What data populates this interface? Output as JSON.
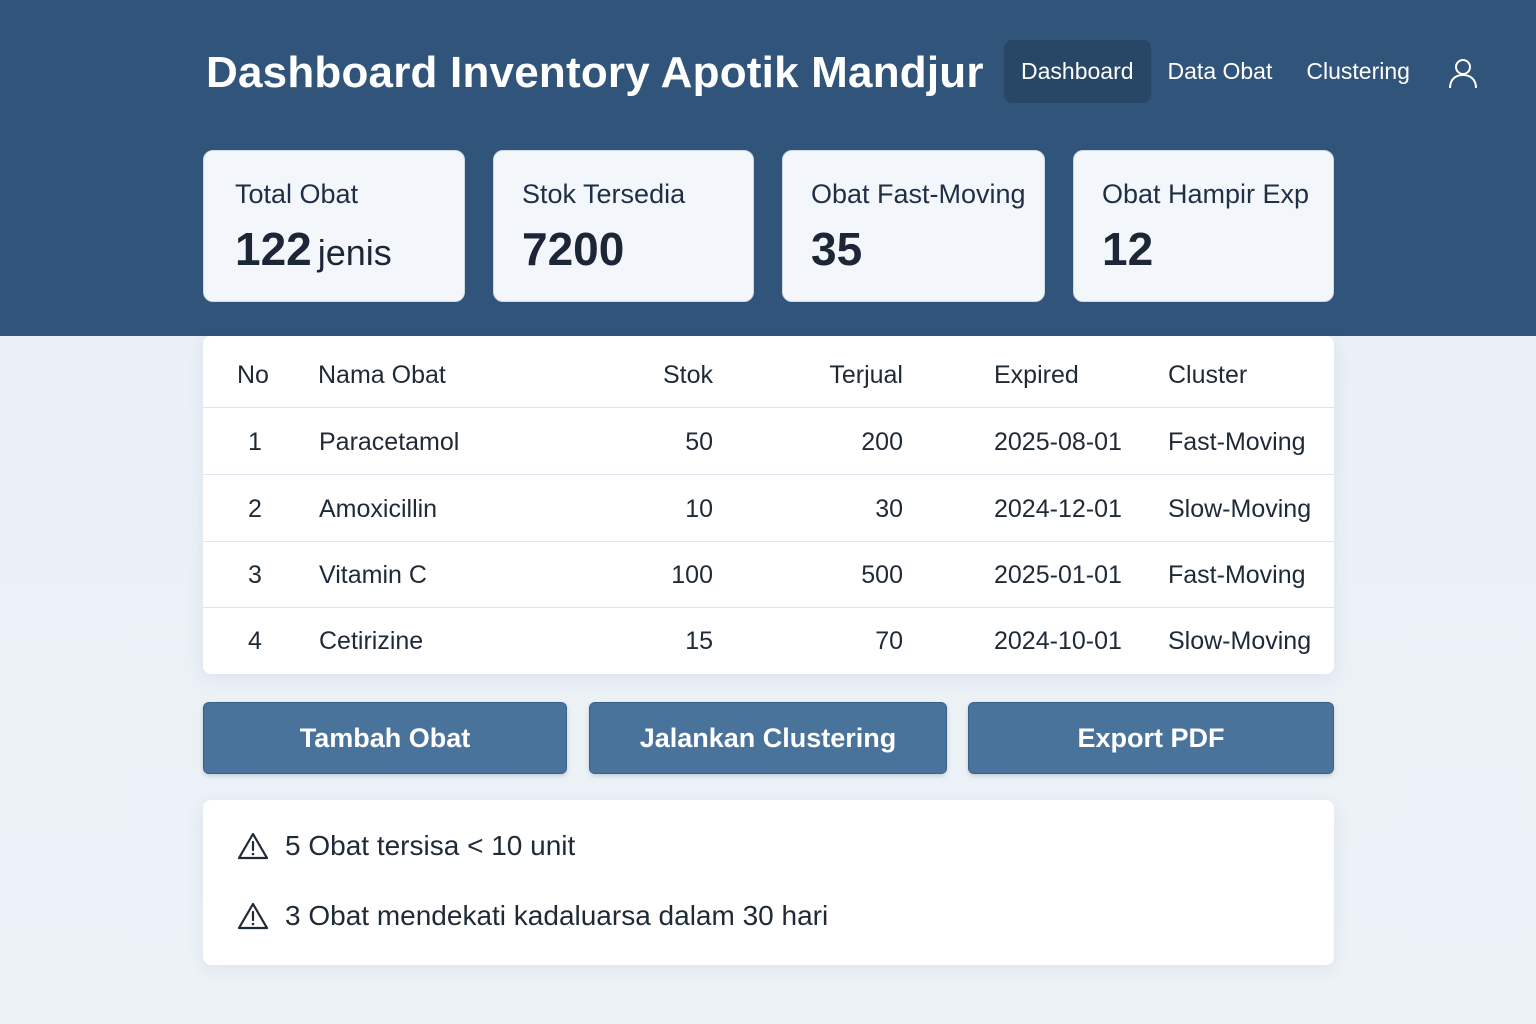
{
  "app": {
    "title": "Dashboard Inventory Apotik Mandjur"
  },
  "nav": {
    "items": [
      {
        "label": "Dashboard",
        "active": true
      },
      {
        "label": "Data Obat",
        "active": false
      },
      {
        "label": "Clustering",
        "active": false
      }
    ],
    "user_icon": "user-icon"
  },
  "stats": [
    {
      "label": "Total Obat",
      "value": "122",
      "unit": "jenis"
    },
    {
      "label": "Stok Tersedia",
      "value": "7200",
      "unit": ""
    },
    {
      "label": "Obat Fast-Moving",
      "value": "35",
      "unit": ""
    },
    {
      "label": "Obat Hampir Exp",
      "value": "12",
      "unit": ""
    }
  ],
  "table": {
    "headers": [
      "No",
      "Nama Obat",
      "Stok",
      "Terjual",
      "Expired",
      "Cluster"
    ],
    "rows": [
      [
        "1",
        "Paracetamol",
        "50",
        "200",
        "2025-08-01",
        "Fast-Moving"
      ],
      [
        "2",
        "Amoxicillin",
        "10",
        "30",
        "2024-12-01",
        "Slow-Moving"
      ],
      [
        "3",
        "Vitamin C",
        "100",
        "500",
        "2025-01-01",
        "Fast-Moving"
      ],
      [
        "4",
        "Cetirizine",
        "15",
        "70",
        "2024-10-01",
        "Slow-Moving"
      ]
    ]
  },
  "actions": {
    "add": "Tambah Obat",
    "cluster": "Jalankan Clustering",
    "export": "Export PDF"
  },
  "alerts": [
    {
      "icon": "warning-icon",
      "text": "5 Obat tersisa < 10 unit"
    },
    {
      "icon": "warning-icon",
      "text": "3 Obat mendekati kadaluarsa dalam 30 hari"
    }
  ],
  "colors": {
    "header_bg": "#31547a",
    "nav_active_bg": "#284766",
    "button_bg": "#4a739b",
    "page_bg": "#e8eef4",
    "card_bg": "#f3f7fb"
  }
}
